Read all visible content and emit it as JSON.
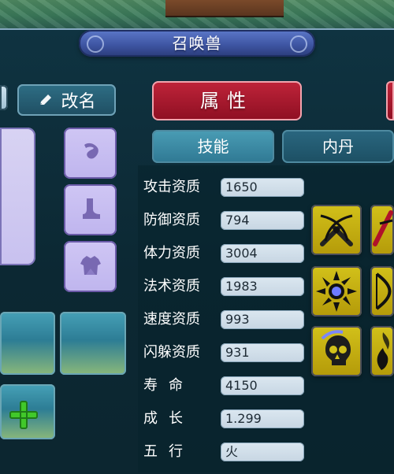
{
  "window": {
    "title": "召唤兽"
  },
  "left_panel": {
    "rename_label": "改名",
    "icons": [
      "pencil-icon",
      "horn-icon",
      "boot-icon",
      "armor-icon",
      "plus-icon"
    ]
  },
  "tabs": {
    "main_tab_label": "属性",
    "subtabs": [
      "技能",
      "内丹"
    ]
  },
  "stats": [
    {
      "label": "攻击资质",
      "value": "1650"
    },
    {
      "label": "防御资质",
      "value": "794"
    },
    {
      "label": "体力资质",
      "value": "3004"
    },
    {
      "label": "法术资质",
      "value": "1983"
    },
    {
      "label": "速度资质",
      "value": "993"
    },
    {
      "label": "闪躲资质",
      "value": "931"
    },
    {
      "label": "寿命",
      "value": "4150"
    },
    {
      "label": "成长",
      "value": "1.299"
    },
    {
      "label": "五行",
      "value": "火"
    }
  ],
  "skills": {
    "icons": [
      "crossed-swords-icon",
      "strike-icon",
      "sunburst-icon",
      "bow-icon",
      "skull-icon",
      "fire-icon"
    ]
  },
  "colors": {
    "panel_bg": "#0f2a35",
    "title_blue": "#3f56a4",
    "attr_red": "#a11830",
    "skill_yellow": "#c9b412",
    "plus_green": "#41c82a"
  }
}
